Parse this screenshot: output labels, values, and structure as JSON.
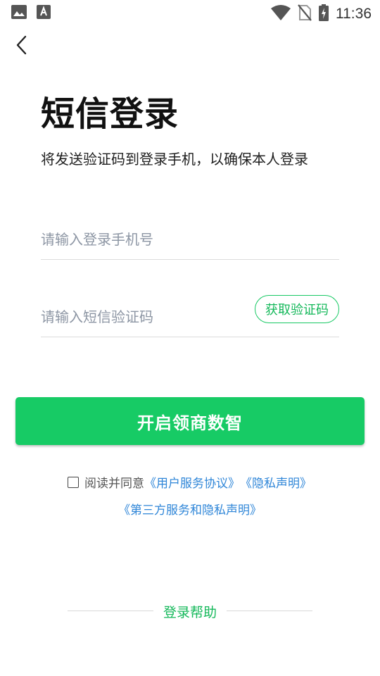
{
  "status_bar": {
    "time": "11:36",
    "icons": [
      "image-icon",
      "text-recognition-icon",
      "wifi-icon",
      "no-sim-icon",
      "battery-charging-icon"
    ]
  },
  "header": {
    "title": "短信登录",
    "subtitle": "将发送验证码到登录手机，以确保本人登录"
  },
  "form": {
    "phone_placeholder": "请输入登录手机号",
    "code_placeholder": "请输入短信验证码",
    "get_code_label": "获取验证码"
  },
  "primary_button": "开启领商数智",
  "agreement": {
    "prefix": "阅读并同意",
    "user_agreement": "《用户服务协议》",
    "privacy": "《隐私声明》",
    "third_party": "《第三方服务和隐私声明》"
  },
  "help": {
    "label": "登录帮助"
  },
  "colors": {
    "brand_green": "#17cb65",
    "link_blue": "#2f86d8"
  }
}
